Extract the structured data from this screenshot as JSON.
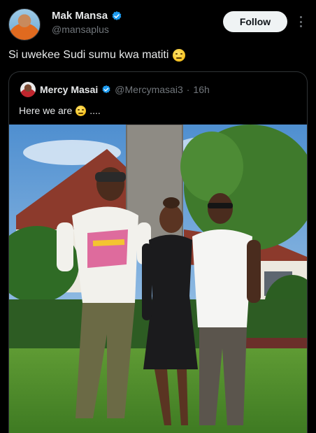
{
  "author": {
    "display_name": "Mak Mansa",
    "handle": "@mansaplus",
    "avatar_icon": "user-avatar"
  },
  "follow_label": "Follow",
  "tweet": {
    "text": "Si uwekee Sudi sumu kwa matiti",
    "emoji": "unamused-face-emoji"
  },
  "quoted": {
    "display_name": "Mercy Masai",
    "handle": "@Mercymasai3",
    "separator": "·",
    "time": "16h",
    "text": "Here we are",
    "emoji": "grimacing-face-emoji",
    "text_suffix": "....",
    "photo_icon": "group-photo"
  },
  "colors": {
    "background": "#000000",
    "verified": "#1d9bf0",
    "text": "#e7e9ea",
    "muted": "#71767b",
    "follow_bg": "#eff3f4"
  }
}
